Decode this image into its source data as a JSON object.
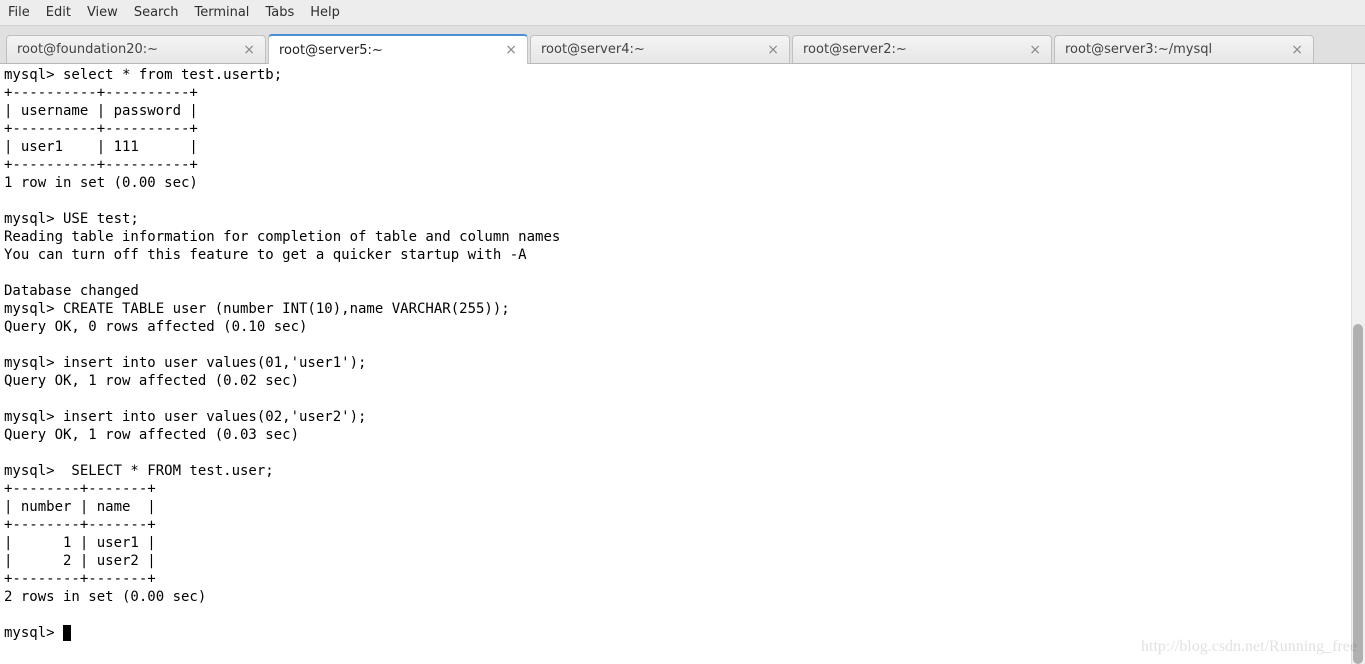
{
  "menu": {
    "items": [
      "File",
      "Edit",
      "View",
      "Search",
      "Terminal",
      "Tabs",
      "Help"
    ]
  },
  "tabs": [
    {
      "label": "root@foundation20:~",
      "active": false
    },
    {
      "label": "root@server5:~",
      "active": true
    },
    {
      "label": "root@server4:~",
      "active": false
    },
    {
      "label": "root@server2:~",
      "active": false
    },
    {
      "label": "root@server3:~/mysql",
      "active": false
    }
  ],
  "terminal": {
    "lines": [
      "mysql> select * from test.usertb;",
      "+----------+----------+",
      "| username | password |",
      "+----------+----------+",
      "| user1    | 111      |",
      "+----------+----------+",
      "1 row in set (0.00 sec)",
      "",
      "mysql> USE test;",
      "Reading table information for completion of table and column names",
      "You can turn off this feature to get a quicker startup with -A",
      "",
      "Database changed",
      "mysql> CREATE TABLE user (number INT(10),name VARCHAR(255));",
      "Query OK, 0 rows affected (0.10 sec)",
      "",
      "mysql> insert into user values(01,'user1');",
      "Query OK, 1 row affected (0.02 sec)",
      "",
      "mysql> insert into user values(02,'user2');",
      "Query OK, 1 row affected (0.03 sec)",
      "",
      "mysql>  SELECT * FROM test.user;",
      "+--------+-------+",
      "| number | name  |",
      "+--------+-------+",
      "|      1 | user1 |",
      "|      2 | user2 |",
      "+--------+-------+",
      "2 rows in set (0.00 sec)",
      "",
      "mysql> "
    ],
    "prompt_cursor": true
  },
  "watermark": "http://blog.csdn.net/Running_free"
}
